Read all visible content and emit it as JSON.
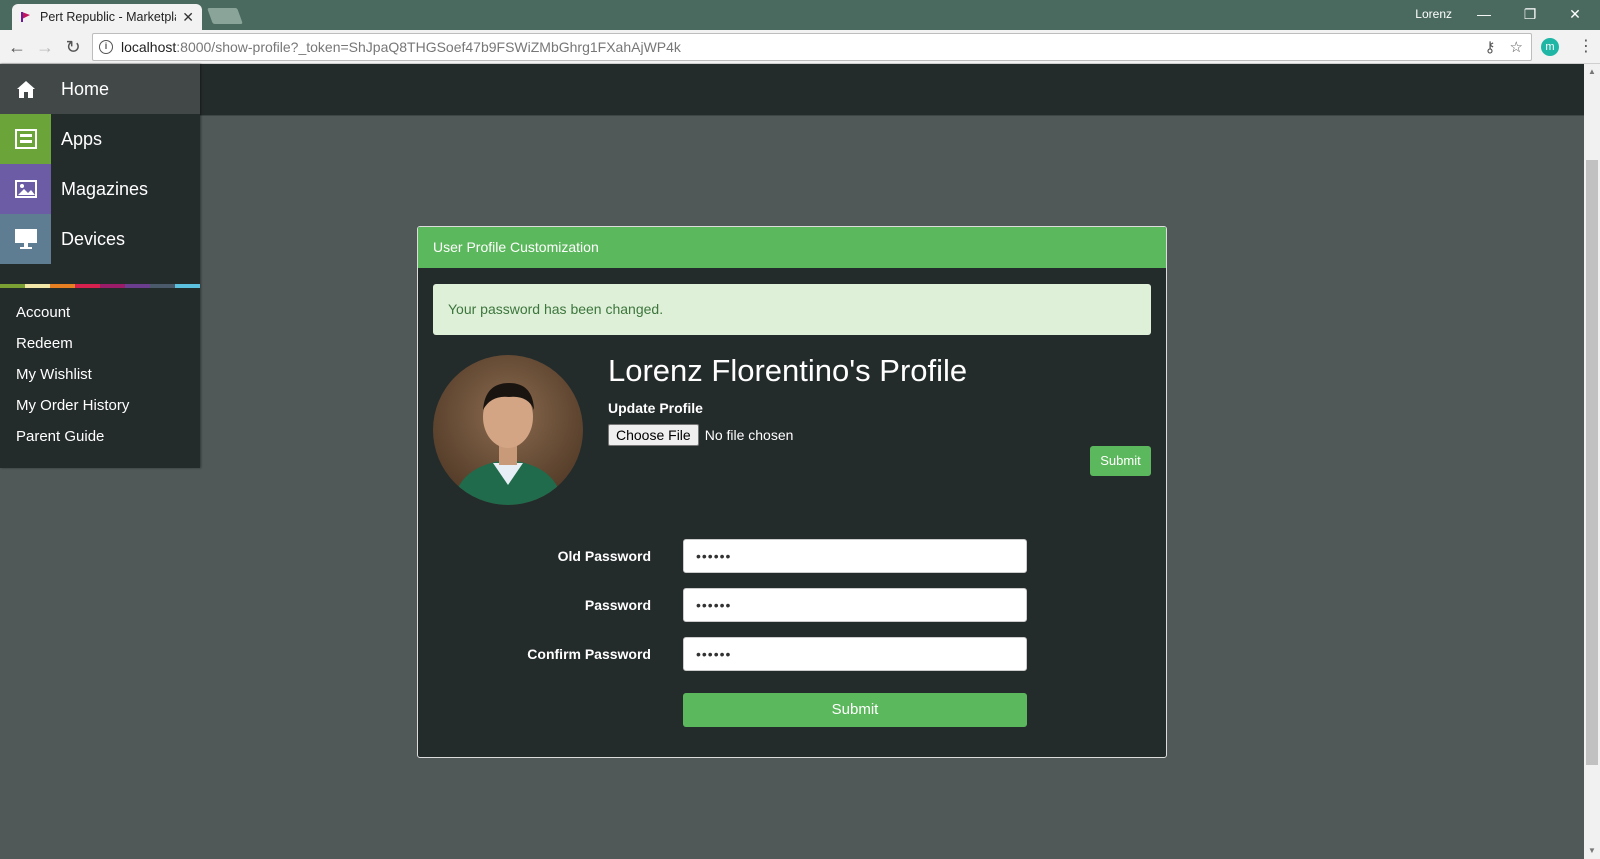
{
  "browser": {
    "tab_title": "Pert Republic - Marketplace",
    "window_user": "Lorenz",
    "url_host": "localhost",
    "url_path": ":8000/show-profile?_token=ShJpaQ8THGSoef47b9FSWiZMbGhrg1FXahAjWP4k",
    "extension_letter": "m"
  },
  "sidebar": {
    "nav": [
      {
        "label": "Home",
        "icon": "home-icon",
        "color": "#424848"
      },
      {
        "label": "Apps",
        "icon": "apps-icon",
        "color": "#6ba539"
      },
      {
        "label": "Magazines",
        "icon": "image-icon",
        "color": "#6b5ca5"
      },
      {
        "label": "Devices",
        "icon": "monitor-icon",
        "color": "#5e7d93"
      }
    ],
    "links": [
      "Account",
      "Redeem",
      "My Wishlist",
      "My Order History",
      "Parent Guide"
    ],
    "colorbar": [
      "#7aa034",
      "#f2e7a7",
      "#e67e22",
      "#d6204e",
      "#9b1c68",
      "#6a3d8f",
      "#4a5a6a",
      "#5bc0de"
    ]
  },
  "card": {
    "header": "User Profile Customization",
    "alert": "Your password has been changed.",
    "profile_title": "Lorenz Florentino's Profile",
    "update_label": "Update Profile",
    "choose_file": "Choose File",
    "no_file": "No file chosen",
    "submit_small": "Submit",
    "fields": [
      {
        "label": "Old Password",
        "value": "••••••"
      },
      {
        "label": "Password",
        "value": "••••••"
      },
      {
        "label": "Confirm Password",
        "value": "••••••"
      }
    ],
    "submit_wide": "Submit"
  },
  "colors": {
    "accent": "#5cb85c",
    "page_bg": "#515858",
    "panel_bg": "#242b2b",
    "alert_bg": "#dff0d8"
  }
}
